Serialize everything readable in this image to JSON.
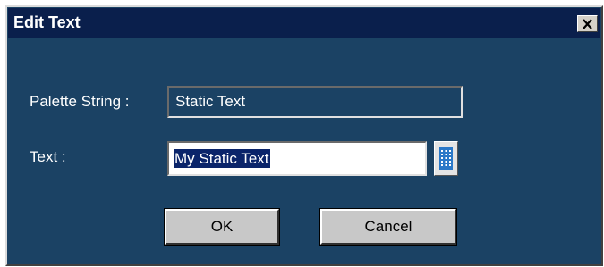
{
  "dialog": {
    "title": "Edit Text",
    "close_symbol": "×"
  },
  "fields": {
    "palette_label": "Palette String :",
    "palette_value": "Static Text",
    "text_label": "Text :",
    "text_value": "My Static Text"
  },
  "buttons": {
    "ok_label": "OK",
    "cancel_label": "Cancel"
  },
  "icons": {
    "close": "close-icon",
    "keypad": "keypad-grid-icon"
  },
  "colors": {
    "dialog_bg": "#1b4264",
    "titlebar_bg": "#0a1f4c",
    "selection": "#0a246a",
    "button_face": "#c8c8c8"
  }
}
